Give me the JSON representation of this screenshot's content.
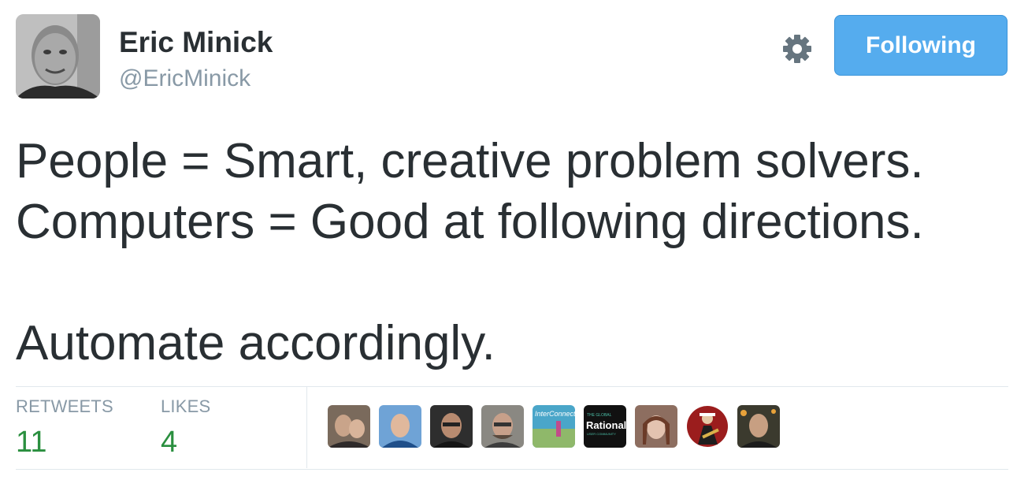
{
  "author": {
    "name": "Eric Minick",
    "handle": "@EricMinick"
  },
  "actions": {
    "follow_label": "Following",
    "settings_icon": "gear-icon"
  },
  "tweet": {
    "lines": [
      "People = Smart, creative problem solvers.",
      "Computers = Good at following directions.",
      "",
      "Automate accordingly."
    ]
  },
  "stats": {
    "retweets_label": "RETWEETS",
    "retweets_count": "11",
    "likes_label": "LIKES",
    "likes_count": "4"
  },
  "likers": [
    {
      "name": "liker-avatar-1",
      "bg": "#7a6a5c"
    },
    {
      "name": "liker-avatar-2",
      "bg": "#5b8ec4"
    },
    {
      "name": "liker-avatar-3",
      "bg": "#3a3a3a"
    },
    {
      "name": "liker-avatar-4",
      "bg": "#6f6e6a"
    },
    {
      "name": "liker-avatar-5",
      "bg": "#4aa6c9",
      "text": "InterConnect"
    },
    {
      "name": "liker-avatar-6",
      "bg": "#111111",
      "text": "Rational"
    },
    {
      "name": "liker-avatar-7",
      "bg": "#a98c7c"
    },
    {
      "name": "liker-avatar-8",
      "bg": "#ffffff"
    },
    {
      "name": "liker-avatar-9",
      "bg": "#3b3a2e"
    }
  ],
  "colors": {
    "accent": "#55acee",
    "count_green": "#2a8f3f",
    "muted": "#8899a6",
    "text": "#292f33"
  }
}
